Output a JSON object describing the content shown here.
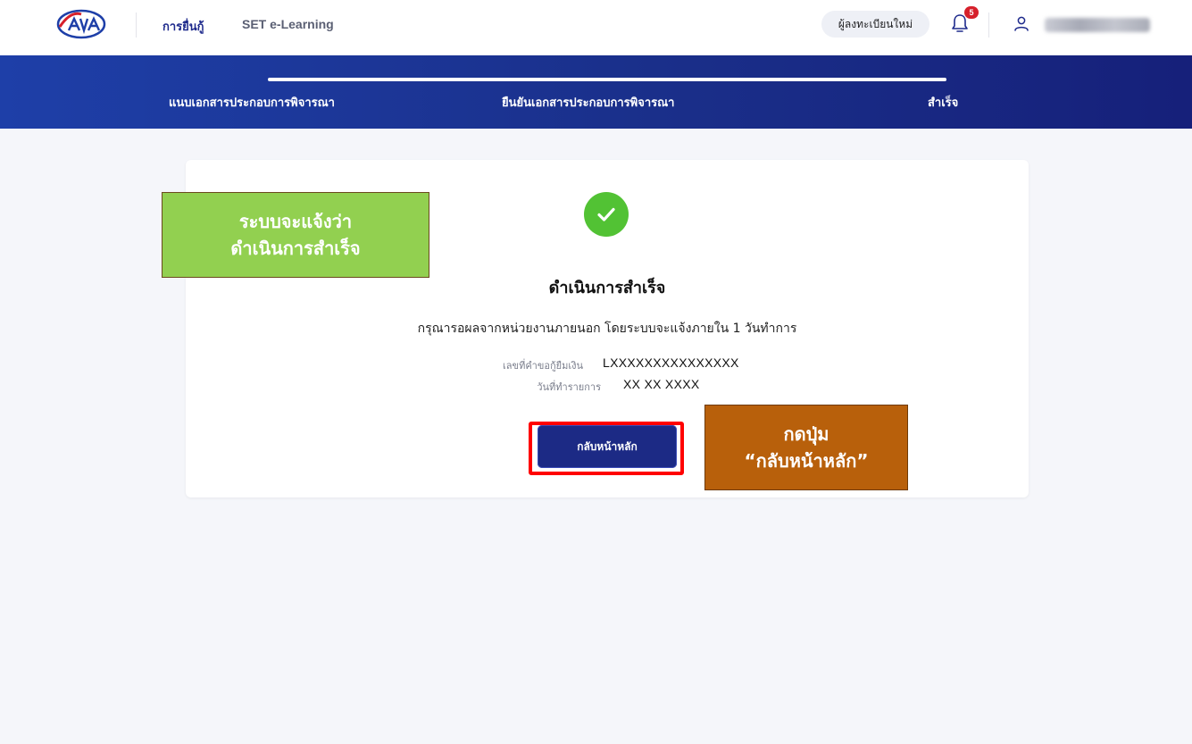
{
  "nav": {
    "logo_icon": "brand-logo",
    "links": [
      {
        "label": "การยื่นกู้"
      },
      {
        "label": "SET e-Learning"
      }
    ],
    "register_label": "ผู้ลงทะเบียนใหม่",
    "notification_count": "5",
    "user_name": "",
    "accent": "#1e2a8c"
  },
  "steps": {
    "items": [
      {
        "label": "แนบเอกสารประกอบการพิจารณา"
      },
      {
        "label": "ยืนยันเอกสารประกอบการพิจารณา"
      },
      {
        "label": "สำเร็จ"
      }
    ]
  },
  "result": {
    "status_icon": "check-circle-icon",
    "title": "ดำเนินการสำเร็จ",
    "description": "กรุณารอผลจากหน่วยงานภายนอก โดยระบบจะแจ้งภายใน 1 วันทำการ",
    "fields": [
      {
        "label": "เลขที่คำขอกู้ยืมเงิน",
        "value": "LXXXXXXXXXXXXXXX"
      },
      {
        "label": "วันที่ทำรายการ",
        "value": "XX XX XXXX"
      }
    ],
    "back_button_label": "กลับหน้าหลัก"
  },
  "annotations": {
    "green_callout": {
      "line1": "ระบบจะแจ้งว่า",
      "line2": "ดำเนินการสำเร็จ"
    },
    "orange_callout": {
      "line1": "กดปุ่ม",
      "line2": "“กลับหน้าหลัก”"
    },
    "highlight_color": "#ff0000"
  },
  "colors": {
    "success": "#52c234",
    "primary_button": "#1c2a85",
    "step_band": "#1a2f8a"
  }
}
